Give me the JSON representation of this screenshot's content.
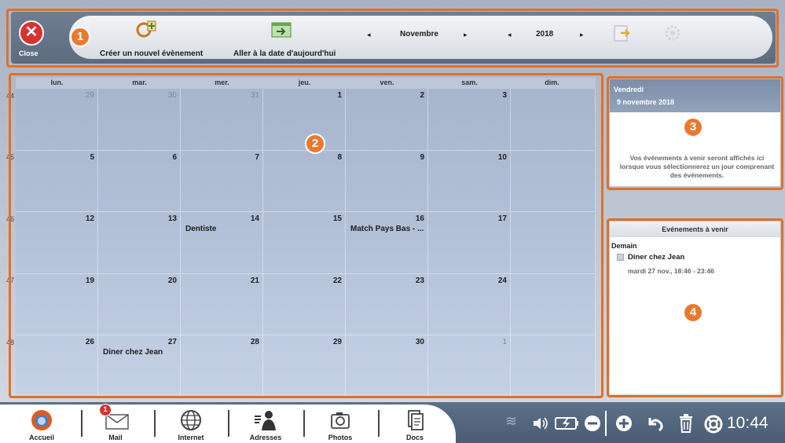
{
  "toolbar": {
    "close_label": "Close",
    "new_event_label": "Créer un nouvel évènement",
    "goto_today_label": "Aller à la date d'aujourd'hui",
    "month_prev": "◂",
    "month": "Novembre",
    "month_next": "▸",
    "year_prev": "◂",
    "year": "2018",
    "year_next": "▸"
  },
  "callouts": [
    "1",
    "2",
    "3",
    "4"
  ],
  "calendar": {
    "days_of_week": [
      "lun.",
      "mar.",
      "mer.",
      "jeu.",
      "ven.",
      "sam.",
      "dim."
    ],
    "week_numbers": [
      "44",
      "45",
      "46",
      "47",
      "48"
    ],
    "weeks": [
      [
        {
          "day": "29",
          "other": true
        },
        {
          "day": "30",
          "other": true
        },
        {
          "day": "31",
          "other": true
        },
        {
          "day": "1"
        },
        {
          "day": "2"
        },
        {
          "day": "3"
        },
        {
          "day": ""
        }
      ],
      [
        {
          "day": "5"
        },
        {
          "day": "6"
        },
        {
          "day": "7"
        },
        {
          "day": "8"
        },
        {
          "day": "9"
        },
        {
          "day": "10"
        },
        {
          "day": ""
        }
      ],
      [
        {
          "day": "12"
        },
        {
          "day": "13"
        },
        {
          "day": "14",
          "event": "Dentiste"
        },
        {
          "day": "15"
        },
        {
          "day": "16",
          "event": "Match Pays Bas - ..."
        },
        {
          "day": "17"
        },
        {
          "day": ""
        }
      ],
      [
        {
          "day": "19"
        },
        {
          "day": "20"
        },
        {
          "day": "21"
        },
        {
          "day": "22"
        },
        {
          "day": "23"
        },
        {
          "day": "24"
        },
        {
          "day": ""
        }
      ],
      [
        {
          "day": "26"
        },
        {
          "day": "27",
          "event": "Diner chez Jean"
        },
        {
          "day": "28"
        },
        {
          "day": "29"
        },
        {
          "day": "30"
        },
        {
          "day": "1",
          "other": true
        },
        {
          "day": ""
        }
      ]
    ]
  },
  "day_panel": {
    "weekday": "Vendredi",
    "date": "9 novembre 2018",
    "empty_message": "Vos événements à venir seront affichés ici lorsque vous sélectionnerez un jour comprenant des événements."
  },
  "upcoming_panel": {
    "title": "Evénements à venir",
    "group": "Demain",
    "event_title": "Diner chez Jean",
    "event_time": "mardi 27 nov., 18:46 - 23:46"
  },
  "dock": {
    "items": [
      "Accueil",
      "Mail",
      "Internet",
      "Adresses",
      "Photos",
      "Docs"
    ],
    "mail_badge": "1",
    "clock": "10:44"
  },
  "colors": {
    "accent_orange": "#e0702a",
    "close_red": "#d8322e",
    "calendar_blue": "#a6b4cc"
  }
}
